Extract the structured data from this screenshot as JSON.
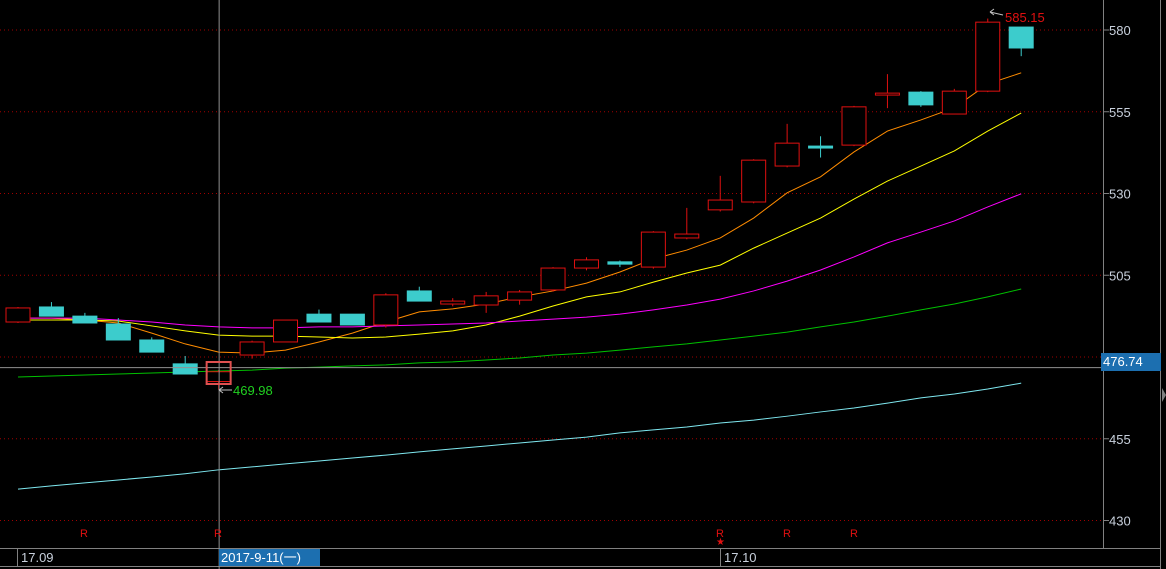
{
  "chart_data": {
    "type": "candlestick",
    "ylim": [
      423,
      589
    ],
    "yticks": [
      "580",
      "555",
      "530",
      "505",
      "455",
      "430"
    ],
    "ytick_values": [
      580,
      555,
      530,
      505,
      455,
      430
    ],
    "grid_values": [
      580,
      555,
      530,
      505,
      480,
      455,
      430
    ],
    "candles": [
      [
        490.7,
        495.3,
        490.4,
        495.0
      ],
      [
        495.3,
        496.8,
        492.5,
        492.5
      ],
      [
        492.5,
        493.5,
        490.4,
        490.4
      ],
      [
        490.1,
        491.9,
        485.2,
        485.2
      ],
      [
        485.2,
        486.0,
        481.5,
        481.5
      ],
      [
        477.9,
        480.3,
        474.8,
        474.8
      ],
      [
        472.5,
        476.0,
        469.98,
        475.5
      ],
      [
        480.6,
        485.0,
        479.5,
        484.6
      ],
      [
        484.6,
        491.3,
        484.6,
        491.3
      ],
      [
        493.1,
        494.5,
        490.7,
        490.7
      ],
      [
        493.1,
        493.1,
        489.8,
        489.8
      ],
      [
        489.8,
        499.5,
        489.0,
        499.0
      ],
      [
        500.2,
        501.5,
        497.1,
        497.1
      ],
      [
        496.2,
        498.0,
        495.5,
        497.1
      ],
      [
        495.9,
        499.9,
        493.5,
        498.7
      ],
      [
        497.4,
        500.5,
        496.0,
        499.9
      ],
      [
        500.5,
        507.5,
        500.0,
        507.2
      ],
      [
        507.2,
        510.5,
        506.5,
        509.7
      ],
      [
        509.1,
        509.5,
        507.5,
        508.4
      ],
      [
        507.5,
        518.5,
        507.0,
        518.2
      ],
      [
        516.4,
        525.6,
        516.0,
        517.6
      ],
      [
        525.0,
        535.4,
        524.5,
        528.0
      ],
      [
        527.4,
        540.5,
        527.0,
        540.2
      ],
      [
        538.4,
        551.3,
        538.0,
        545.4
      ],
      [
        544.5,
        547.5,
        541.0,
        543.9
      ],
      [
        544.8,
        556.8,
        544.5,
        556.5
      ],
      [
        560.1,
        566.5,
        556.1,
        560.7
      ],
      [
        561.0,
        561.3,
        556.5,
        557.1
      ],
      [
        554.3,
        562.0,
        554.3,
        561.3
      ],
      [
        561.3,
        583.5,
        561.0,
        582.4
      ],
      [
        580.9,
        580.9,
        572.0,
        574.5
      ]
    ],
    "selected_index": 6,
    "series": [
      {
        "name": "ma-orange",
        "color": "#ff8c00",
        "values": [
          491.9,
          491.9,
          491.3,
          490.4,
          487.3,
          484.0,
          481.5,
          481.2,
          482.1,
          484.6,
          487.3,
          490.7,
          493.8,
          494.7,
          496.2,
          498.4,
          500.2,
          502.6,
          506.0,
          510.0,
          512.7,
          516.4,
          522.5,
          530.2,
          535.1,
          542.7,
          549.1,
          552.5,
          556.2,
          563.5,
          566.9
        ]
      },
      {
        "name": "ma-yellow",
        "color": "#ffff00",
        "values": [
          491.3,
          491.3,
          491.3,
          491.0,
          489.5,
          488.0,
          486.7,
          486.4,
          486.4,
          486.1,
          485.8,
          486.1,
          487.0,
          488.0,
          489.8,
          492.5,
          495.6,
          498.4,
          499.9,
          502.9,
          505.7,
          508.1,
          513.3,
          517.9,
          522.5,
          528.3,
          533.8,
          538.4,
          543.0,
          549.1,
          554.6
        ]
      },
      {
        "name": "ma-magenta",
        "color": "#ff00ff",
        "values": [
          491.9,
          491.9,
          491.9,
          491.3,
          490.7,
          489.8,
          489.2,
          488.9,
          488.9,
          489.2,
          489.2,
          489.5,
          489.8,
          490.1,
          490.4,
          491.0,
          491.6,
          492.2,
          493.1,
          494.4,
          495.9,
          497.7,
          500.2,
          503.2,
          506.6,
          510.6,
          514.9,
          518.2,
          521.6,
          525.9,
          529.9
        ]
      },
      {
        "name": "ma-green",
        "color": "#00c000",
        "values": [
          473.9,
          474.2,
          474.5,
          474.8,
          475.1,
          475.4,
          475.7,
          476.0,
          476.6,
          476.9,
          477.3,
          477.6,
          478.2,
          478.5,
          479.1,
          479.7,
          480.6,
          481.2,
          482.1,
          483.1,
          484.0,
          485.2,
          486.4,
          487.6,
          489.2,
          490.7,
          492.5,
          494.4,
          496.2,
          498.4,
          500.8
        ]
      },
      {
        "name": "ma-cyan",
        "color": "#7fe8f0",
        "values": [
          439.6,
          440.6,
          441.5,
          442.4,
          443.3,
          444.3,
          445.5,
          446.4,
          447.3,
          448.2,
          449.1,
          450.0,
          451.0,
          451.9,
          452.8,
          453.7,
          454.6,
          455.5,
          456.8,
          457.7,
          458.6,
          459.8,
          460.7,
          461.9,
          463.2,
          464.4,
          465.9,
          467.5,
          468.7,
          470.2,
          472.0
        ]
      }
    ],
    "crosshair_value": 476.74,
    "high_label": "585.15",
    "low_label": "469.98",
    "colors": {
      "up": "#e01010",
      "down": "#3ccccc",
      "grid": "#a00000",
      "axis": "#808080"
    }
  },
  "xaxis": {
    "label_start": "17.09",
    "label_mid": "17.10",
    "selected_date": "2017-9-11(一)"
  },
  "crosshair_price_label": "476.74",
  "markers": [
    "R",
    "R",
    "R",
    "R",
    "R"
  ],
  "marker_indices": [
    2,
    6,
    21,
    23,
    25
  ],
  "star": "★"
}
